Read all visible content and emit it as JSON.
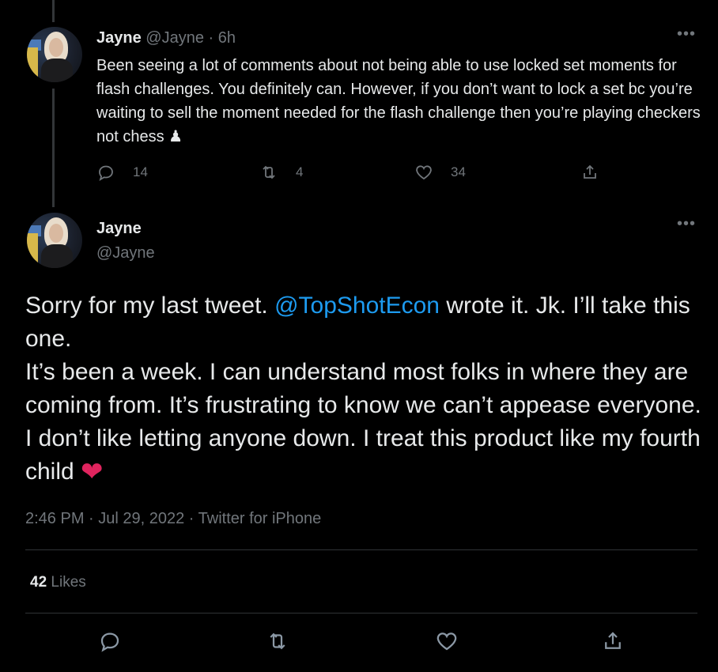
{
  "tweet1": {
    "name": "Jayne",
    "handle": "@Jayne",
    "time": "6h",
    "text": "Been seeing a lot of comments about not being able to use locked set moments for flash challenges. You definitely can. However, if you don’t want to lock a set bc you’re waiting to sell the moment needed for the flash challenge then you’re playing checkers not chess ♟",
    "replies": "14",
    "retweets": "4",
    "likes": "34"
  },
  "tweet2": {
    "name": "Jayne",
    "handle": "@Jayne",
    "text_before_mention": "Sorry for my last tweet. ",
    "mention": "@TopShotEcon",
    "text_after_mention": " wrote it. Jk. I’ll take this one.",
    "text_para2": "It’s been a week. I can understand most folks in where they are coming from. It’s frustrating to know we can’t appease everyone. I don’t like letting anyone down. I treat this product like my fourth child",
    "heart": "❤️",
    "timestamp": "2:46 PM · Jul 29, 2022 · Twitter for iPhone",
    "likes_count": "42",
    "likes_label": "Likes"
  },
  "more_icon": "•••",
  "colors": {
    "background": "#000000",
    "link": "#1d9bf0",
    "muted": "#71767b",
    "heart": "#e0245e"
  },
  "icons": [
    "reply-icon",
    "retweet-icon",
    "like-icon",
    "share-icon",
    "more-icon"
  ]
}
